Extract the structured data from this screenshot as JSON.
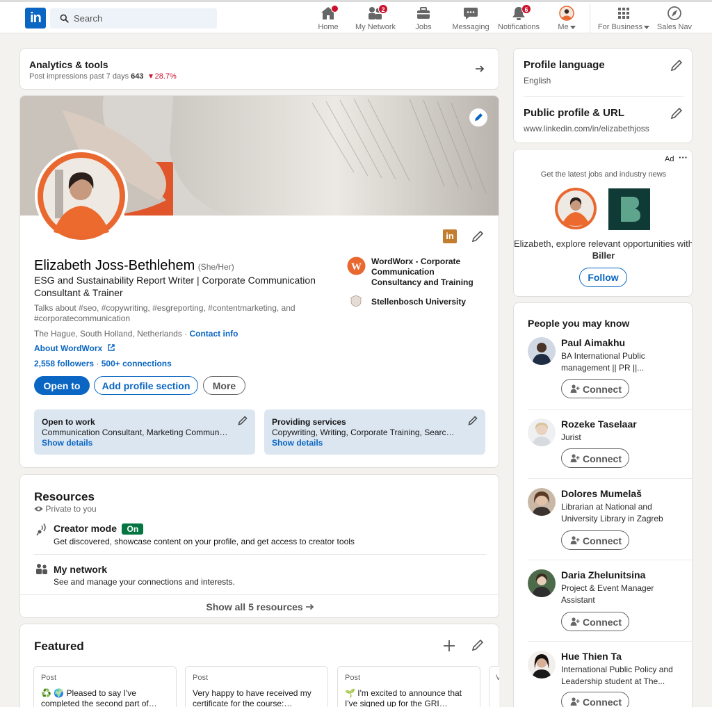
{
  "nav": {
    "logo": "in",
    "search_placeholder": "Search",
    "items": [
      {
        "label": "Home",
        "badge": ""
      },
      {
        "label": "My Network",
        "badge": "2"
      },
      {
        "label": "Jobs",
        "badge": ""
      },
      {
        "label": "Messaging",
        "badge": ""
      },
      {
        "label": "Notifications",
        "badge": "6"
      },
      {
        "label": "Me",
        "badge": ""
      },
      {
        "label": "For Business",
        "badge": ""
      },
      {
        "label": "Sales Nav",
        "badge": ""
      }
    ]
  },
  "analytics": {
    "title": "Analytics & tools",
    "subtitle": "Post impressions past 7 days",
    "count": "643",
    "change": "28.7%"
  },
  "profile": {
    "name": "Elizabeth Joss-Bethlehem",
    "pronouns": "(She/Her)",
    "headline": "ESG and Sustainability Report Writer | Corporate Communication Consultant & Trainer",
    "talks": "Talks about #seo, #copywriting, #esgreporting, #contentmarketing, and #corporatecommunication",
    "location": "The Hague, South Holland, Netherlands ·",
    "contact": "Contact info",
    "about_link": "About WordWorx",
    "followers": "2,558 followers",
    "connections": "500+ connections",
    "company": "WordWorx - Corporate Communication Consultancy and Training",
    "school": "Stellenbosch University",
    "buttons": {
      "open_to": "Open to",
      "add_section": "Add profile section",
      "more": "More"
    },
    "open_to_work": {
      "title": "Open to work",
      "text": "Communication Consultant, Marketing Commun…",
      "link": "Show details"
    },
    "services": {
      "title": "Providing services",
      "text": "Copywriting, Writing, Corporate Training, Searc…",
      "link": "Show details"
    }
  },
  "resources": {
    "title": "Resources",
    "private": "Private to you",
    "creator_title": "Creator mode",
    "creator_badge": "On",
    "creator_desc": "Get discovered, showcase content on your profile, and get access to creator tools",
    "network_title": "My network",
    "network_desc": "See and manage your connections and interests.",
    "show_all": "Show all 5 resources"
  },
  "featured": {
    "title": "Featured",
    "posts": [
      {
        "kind": "Post",
        "text": "♻️ 🌍 Pleased to say I've completed the second part of…"
      },
      {
        "kind": "Post",
        "text": "Very happy to have received my certificate for the course:…"
      },
      {
        "kind": "Post",
        "text": "🌱 I'm excited to announce that I've signed up for the GRI…"
      },
      {
        "kind": "V",
        "text": ""
      }
    ]
  },
  "sidebar": {
    "lang_title": "Profile language",
    "lang_value": "English",
    "url_title": "Public profile & URL",
    "url_value": "www.linkedin.com/in/elizabethjoss"
  },
  "ad": {
    "label": "Ad",
    "more": "···",
    "tagline": "Get the latest jobs and industry news",
    "text_pre": "Elizabeth, explore relevant opportunities with",
    "company": "Biller",
    "follow": "Follow"
  },
  "pymk": {
    "title": "People you may know",
    "connect_label": "Connect",
    "people": [
      {
        "name": "Paul Aimakhu",
        "title": "BA International Public management || PR ||..."
      },
      {
        "name": "Rozeke Taselaar",
        "title": "Jurist"
      },
      {
        "name": "Dolores Mumelaš",
        "title": "Librarian at National and University Library in Zagreb"
      },
      {
        "name": "Daria Zhelunitsina",
        "title": "Project & Event Manager Assistant"
      },
      {
        "name": "Hue Thien Ta",
        "title": "International Public Policy and Leadership student at The..."
      }
    ]
  },
  "colors": {
    "brand": "#0a66c2",
    "accent_orange": "#e8682f",
    "badge_red": "#cb112d",
    "creator_green": "#057642"
  }
}
